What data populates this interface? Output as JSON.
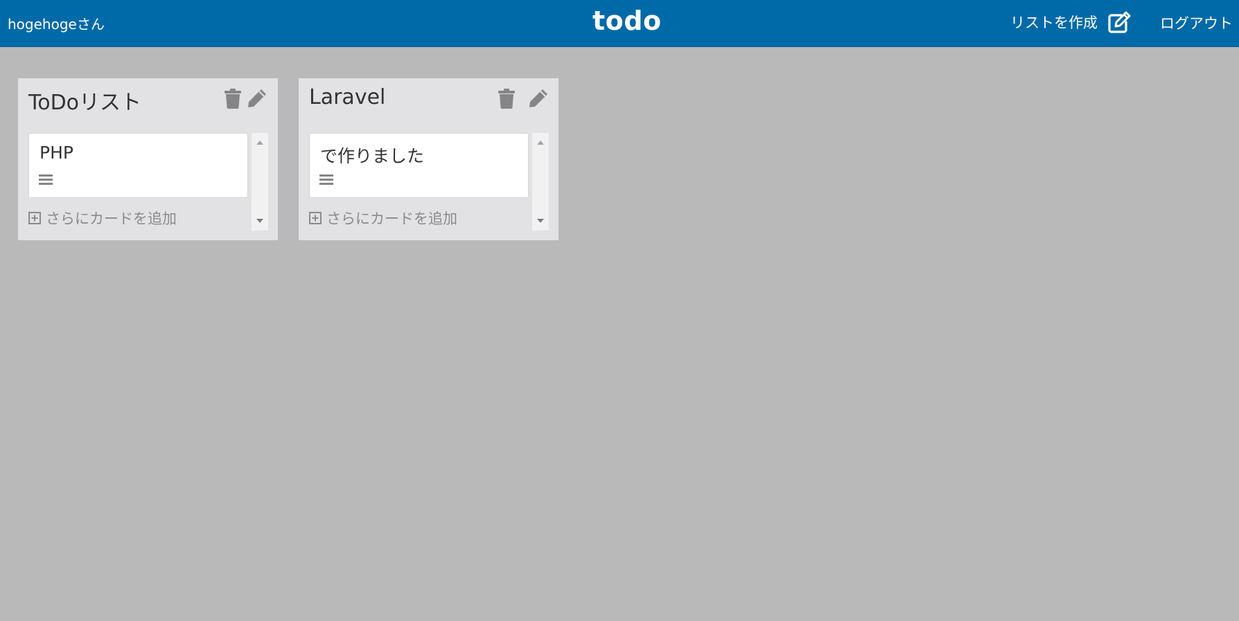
{
  "header": {
    "user_greeting": "hogehogeさん",
    "brand": "todo",
    "create_list_label": "リストを作成",
    "create_list_icon": "edit-icon",
    "logout_label": "ログアウト"
  },
  "lists": [
    {
      "title": "ToDoリスト",
      "delete_icon": "trash-icon",
      "edit_icon": "pencil-icon",
      "cards": [
        {
          "title": "PHP",
          "icon": "description-lines-icon"
        }
      ],
      "add_card_label": "さらにカードを追加"
    },
    {
      "title": "Laravel",
      "delete_icon": "trash-icon",
      "edit_icon": "pencil-icon",
      "cards": [
        {
          "title": "で作りました",
          "icon": "description-lines-icon"
        }
      ],
      "add_card_label": "さらにカードを追加"
    }
  ],
  "colors": {
    "header_bg": "#006aa8",
    "page_bg": "#b9b9b9",
    "list_bg": "#e2e2e4",
    "icon_gray": "#858585"
  }
}
